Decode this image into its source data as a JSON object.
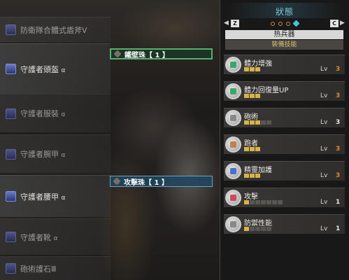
{
  "equipment": [
    {
      "name": "防衛隊合體式盾斧Ⅴ",
      "icon": "charge-blade-icon"
    },
    {
      "name": "守護者頭盔",
      "suffix": "α",
      "icon": "helmet-icon"
    },
    {
      "name": "守護者服裝",
      "suffix": "α",
      "icon": "chest-armor-icon"
    },
    {
      "name": "守護者腕甲",
      "suffix": "α",
      "icon": "arm-armor-icon"
    },
    {
      "name": "守護者腰甲",
      "suffix": "α",
      "icon": "waist-armor-icon"
    },
    {
      "name": "守護者靴",
      "suffix": "α",
      "icon": "leg-armor-icon"
    },
    {
      "name": "砲術護石Ⅲ",
      "icon": "charm-icon"
    }
  ],
  "decorations": [
    {
      "label": "鐵壁珠【 1 】",
      "icon": "decoration-gem-icon"
    },
    {
      "label": "攻擊珠【 1 】",
      "icon": "decoration-gem-icon"
    }
  ],
  "status_panel": {
    "title": "狀態",
    "nav_left_key": "Z",
    "nav_right_key": "C",
    "weapon_type": "热兵器",
    "section": "裝備技能",
    "page_count": 4,
    "active_page": 4,
    "skills": [
      {
        "name": "體力增強",
        "level": "3",
        "lv_label": "Lv",
        "pips_on": 3,
        "pips_total": 3,
        "maxed": true,
        "icon": "health-boost-icon",
        "color": "#3aa86a"
      },
      {
        "name": "體力回復量UP",
        "level": "3",
        "lv_label": "Lv",
        "pips_on": 3,
        "pips_total": 3,
        "maxed": true,
        "icon": "recovery-up-icon",
        "color": "#3aa86a"
      },
      {
        "name": "砲術",
        "level": "3",
        "lv_label": "Lv",
        "pips_on": 3,
        "pips_total": 5,
        "maxed": false,
        "icon": "artillery-icon",
        "color": "#888888"
      },
      {
        "name": "跑者",
        "level": "3",
        "lv_label": "Lv",
        "pips_on": 3,
        "pips_total": 3,
        "maxed": true,
        "icon": "marathon-runner-icon",
        "color": "#c08050"
      },
      {
        "name": "精靈加護",
        "level": "3",
        "lv_label": "Lv",
        "pips_on": 3,
        "pips_total": 3,
        "maxed": true,
        "icon": "divine-blessing-icon",
        "color": "#4a70c8"
      },
      {
        "name": "攻擊",
        "level": "1",
        "lv_label": "Lv",
        "pips_on": 1,
        "pips_total": 7,
        "maxed": false,
        "icon": "attack-boost-icon",
        "color": "#d04860"
      },
      {
        "name": "防禦性能",
        "level": "1",
        "lv_label": "Lv",
        "pips_on": 1,
        "pips_total": 5,
        "maxed": false,
        "icon": "guard-icon",
        "color": "#888888"
      }
    ]
  }
}
